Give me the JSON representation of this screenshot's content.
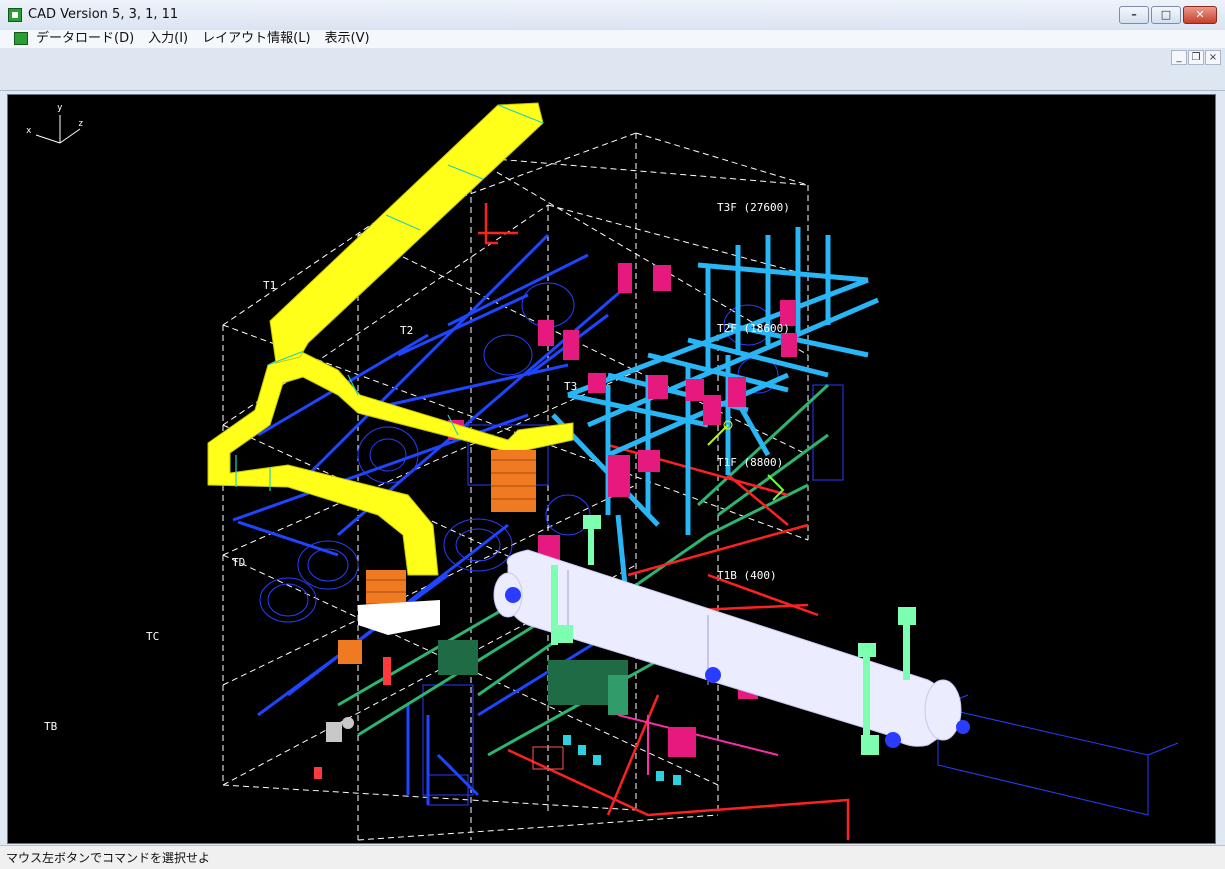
{
  "window": {
    "title": "CAD Version 5, 3, 1, 11"
  },
  "window_buttons": {
    "minimize": "–",
    "maximize": "□",
    "close": "✕"
  },
  "menu": {
    "items": [
      "データロード(D)",
      "入力(I)",
      "レイアウト情報(L)",
      "表示(V)"
    ]
  },
  "mdi_buttons": {
    "minimize": "_",
    "restore": "❐",
    "close": "×"
  },
  "axis_labels": {
    "x": "x",
    "y": "y",
    "z": "z"
  },
  "viewport_labels": {
    "t3f": "T3F (27600)",
    "t2f": "T2F (18600)",
    "t1f": "T1F (8800)",
    "t1b": "T1B (400)",
    "t1": "T1",
    "t2": "T2",
    "t3": "T3",
    "td": "TD",
    "tc": "TC",
    "tb": "TB"
  },
  "colors": {
    "background": "#000000",
    "duct": "#ffff1a",
    "pipe_cyan": "#29b6f6",
    "pipe_blue": "#1e46ff",
    "vessel": "#e6e6ff",
    "magenta": "#e6197f",
    "red": "#ff2020",
    "green": "#27a36b",
    "orange": "#f07a22"
  },
  "status": {
    "text": "マウス左ボタンでコマンドを選択せよ"
  }
}
